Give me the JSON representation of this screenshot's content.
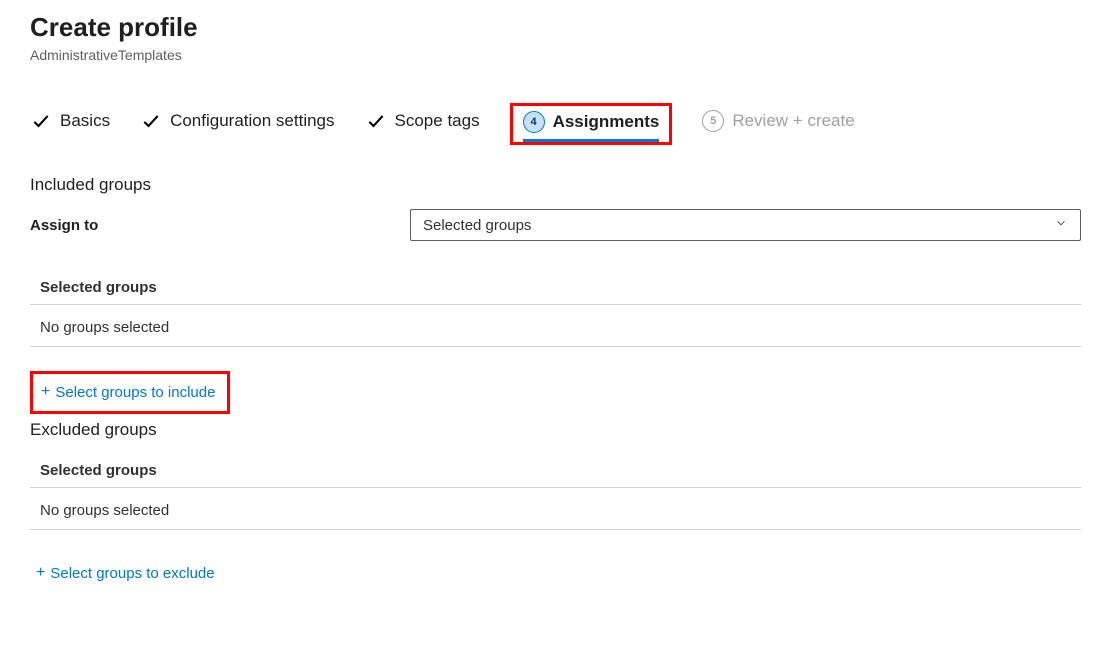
{
  "header": {
    "title": "Create profile",
    "subtitle": "AdministrativeTemplates"
  },
  "stepper": {
    "step1": "Basics",
    "step2": "Configuration settings",
    "step3": "Scope tags",
    "step4_number": "4",
    "step4_label": "Assignments",
    "step5_number": "5",
    "step5_label": "Review + create"
  },
  "included": {
    "section_title": "Included groups",
    "assign_to_label": "Assign to",
    "assign_to_value": "Selected groups",
    "selected_groups_header": "Selected groups",
    "no_groups": "No groups selected",
    "select_link": "Select groups to include"
  },
  "excluded": {
    "section_title": "Excluded groups",
    "selected_groups_header": "Selected groups",
    "no_groups": "No groups selected",
    "select_link": "Select groups to exclude"
  }
}
